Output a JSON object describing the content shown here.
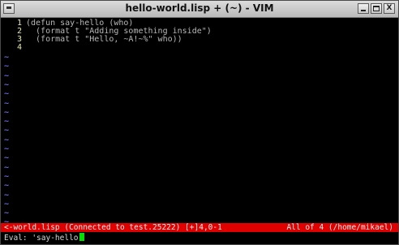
{
  "window": {
    "title": "hello-world.lisp + (~) - VIM",
    "buttons": {
      "menu_icon": "window-menu-icon",
      "minimize_icon": "minimize-icon",
      "maximize_icon": "maximize-icon",
      "close_label": "X"
    }
  },
  "editor": {
    "lines": [
      {
        "number": "1",
        "text": "(defun say-hello (who)"
      },
      {
        "number": "2",
        "text": "  (format t \"Adding something inside\")"
      },
      {
        "number": "3",
        "text": "  (format t \"Hello, ~A!~%\" who))"
      },
      {
        "number": "4",
        "text": ""
      }
    ],
    "empty_marker": "~",
    "empty_line_count": 19
  },
  "statusline": {
    "left": "<-world.lisp (Connected to test.25222) [+]4,0-1",
    "right": "All of 4 (/home/mikael)"
  },
  "cmdline": {
    "text": "Eval: 'say-hello"
  },
  "colors": {
    "background": "#000000",
    "statusline": "#e00000",
    "cursor": "#00e000",
    "tilde": "#6a6ae0"
  }
}
